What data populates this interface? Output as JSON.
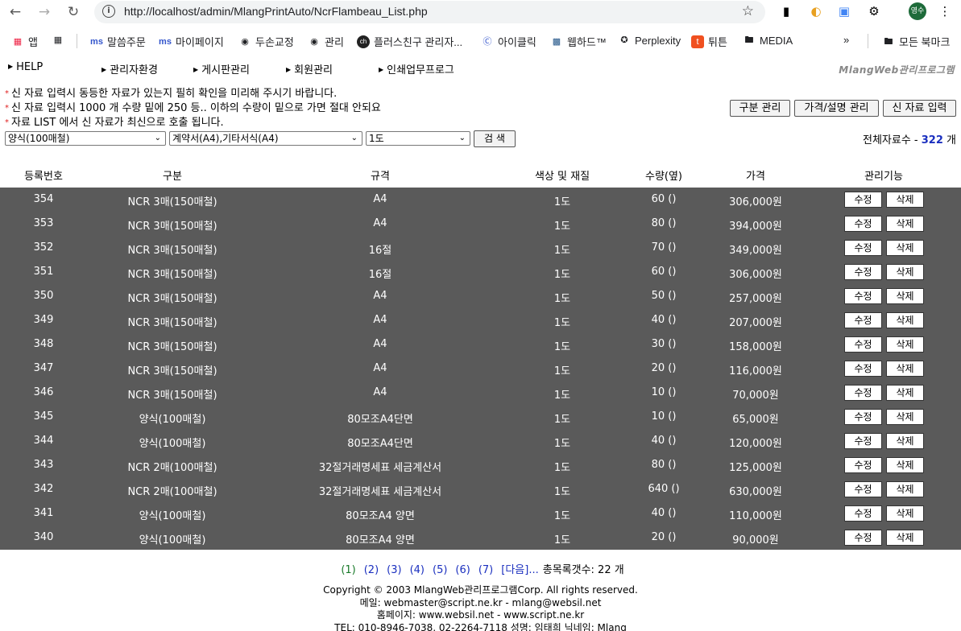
{
  "browser": {
    "url": "http://localhost/admin/MlangPrintAuto/NcrFlambeau_List.php",
    "profile_initials": "영수",
    "bookmarks": [
      "앱",
      "말씀주문",
      "마이페이지",
      "두손교정",
      "관리",
      "플러스친구 관리자...",
      "아이클릭",
      "웹하드™",
      "Perplexity",
      "튀튼",
      "MEDIA",
      "모든 북마크"
    ]
  },
  "admin_menu": {
    "items": [
      "HELP",
      "관리자환경",
      "게시판관리",
      "회원관리",
      "인쇄업무프로그"
    ],
    "brand": "MlangWeb관리프로그램"
  },
  "notices": [
    "신 자료 입력시 동등한 자료가 있는지 필히 확인을 미리해 주시기 바랍니다.",
    "신 자료 입력시 1000 개 수량 밑에 250 등.. 이하의 수량이 밑으로 가면 절대 안되요",
    "자료 LIST 에서 신 자료가 최신으로 호출 됩니다."
  ],
  "actions": {
    "category_manage": "구분 관리",
    "price_manage": "가격/설명 관리",
    "new_entry": "신 자료 입력"
  },
  "filters": {
    "type": "양식(100매철)",
    "spec": "계약서(A4),기타서식(A4)",
    "color": "1도",
    "search_label": "검 색"
  },
  "total": {
    "label": "전체자료수 -",
    "count": "322",
    "unit": "개"
  },
  "table": {
    "headers": [
      "등록번호",
      "구분",
      "규격",
      "색상 및 재질",
      "수량(옆)",
      "가격",
      "관리기능"
    ],
    "edit_label": "수정",
    "delete_label": "삭제",
    "rows": [
      {
        "id": "354",
        "type": "NCR 3매(150매철)",
        "spec": "A4",
        "color": "1도",
        "qty": "60 ()",
        "price": "306,000원"
      },
      {
        "id": "353",
        "type": "NCR 3매(150매철)",
        "spec": "A4",
        "color": "1도",
        "qty": "80 ()",
        "price": "394,000원"
      },
      {
        "id": "352",
        "type": "NCR 3매(150매철)",
        "spec": "16절",
        "color": "1도",
        "qty": "70 ()",
        "price": "349,000원"
      },
      {
        "id": "351",
        "type": "NCR 3매(150매철)",
        "spec": "16절",
        "color": "1도",
        "qty": "60 ()",
        "price": "306,000원"
      },
      {
        "id": "350",
        "type": "NCR 3매(150매철)",
        "spec": "A4",
        "color": "1도",
        "qty": "50 ()",
        "price": "257,000원"
      },
      {
        "id": "349",
        "type": "NCR 3매(150매철)",
        "spec": "A4",
        "color": "1도",
        "qty": "40 ()",
        "price": "207,000원"
      },
      {
        "id": "348",
        "type": "NCR 3매(150매철)",
        "spec": "A4",
        "color": "1도",
        "qty": "30 ()",
        "price": "158,000원"
      },
      {
        "id": "347",
        "type": "NCR 3매(150매철)",
        "spec": "A4",
        "color": "1도",
        "qty": "20 ()",
        "price": "116,000원"
      },
      {
        "id": "346",
        "type": "NCR 3매(150매철)",
        "spec": "A4",
        "color": "1도",
        "qty": "10 ()",
        "price": "70,000원"
      },
      {
        "id": "345",
        "type": "양식(100매철)",
        "spec": "80모조A4단면",
        "color": "1도",
        "qty": "10 ()",
        "price": "65,000원"
      },
      {
        "id": "344",
        "type": "양식(100매철)",
        "spec": "80모조A4단면",
        "color": "1도",
        "qty": "40 ()",
        "price": "120,000원"
      },
      {
        "id": "343",
        "type": "NCR 2매(100매철)",
        "spec": "32절거래명세표 세금계산서",
        "color": "1도",
        "qty": "80 ()",
        "price": "125,000원"
      },
      {
        "id": "342",
        "type": "NCR 2매(100매철)",
        "spec": "32절거래명세표 세금계산서",
        "color": "1도",
        "qty": "640 ()",
        "price": "630,000원"
      },
      {
        "id": "341",
        "type": "양식(100매철)",
        "spec": "80모조A4 양면",
        "color": "1도",
        "qty": "40 ()",
        "price": "110,000원"
      },
      {
        "id": "340",
        "type": "양식(100매철)",
        "spec": "80모조A4 양면",
        "color": "1도",
        "qty": "20 ()",
        "price": "90,000원"
      }
    ]
  },
  "pagination": {
    "pages": [
      "(1)",
      "(2)",
      "(3)",
      "(4)",
      "(5)",
      "(6)",
      "(7)"
    ],
    "next": "[다음]...",
    "total_label": "총목록갯수: 22 개"
  },
  "footer": {
    "lines": [
      "Copyright © 2003 MlangWeb관리프로그램Corp. All rights reserved.",
      "메일: webmaster@script.ne.kr - mlang@websil.net",
      "홈페이지: www.websil.net - www.script.ne.kr",
      "TEL: 010-8946-7038, 02-2264-7118 성명: 임태희 닉네임: Mlang"
    ]
  }
}
